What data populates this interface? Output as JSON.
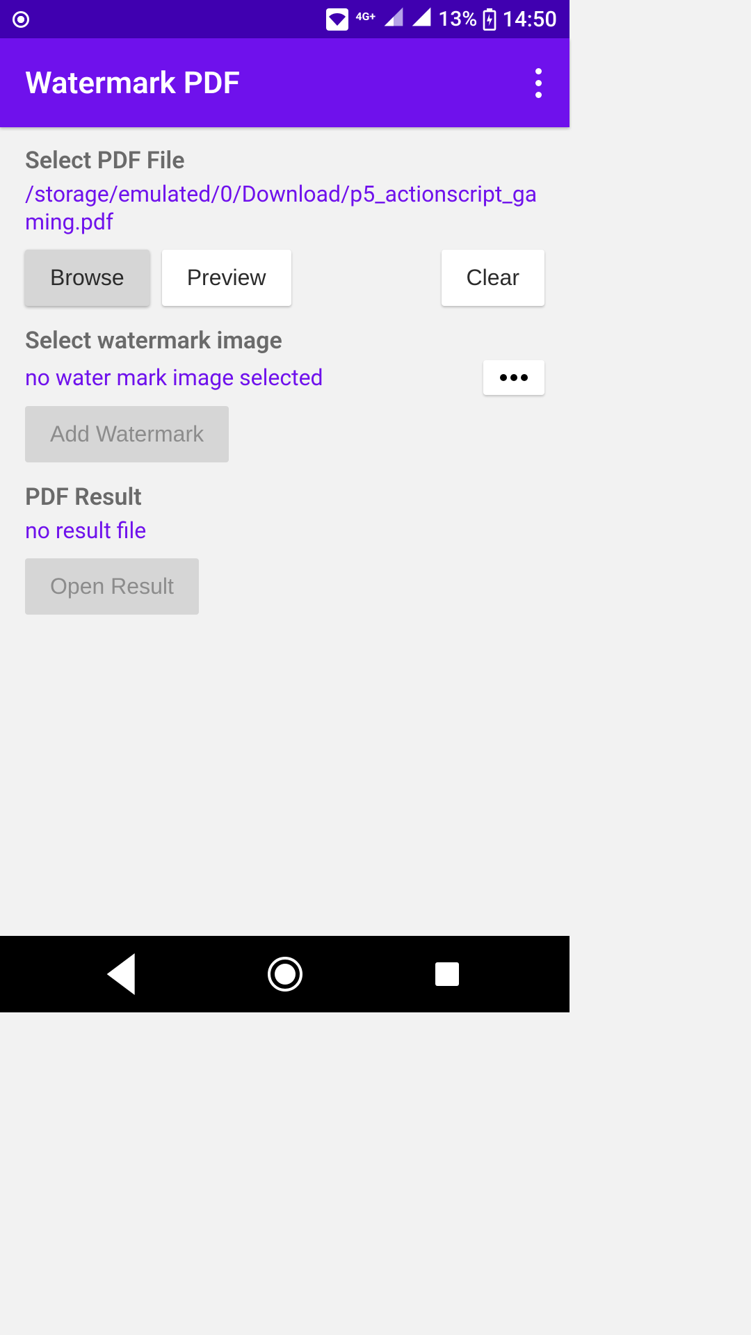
{
  "status": {
    "network_label": "4G+",
    "battery_pct": "13%",
    "time": "14:50"
  },
  "appbar": {
    "title": "Watermark PDF"
  },
  "pdf": {
    "label": "Select PDF File",
    "path": "/storage/emulated/0/Download/p5_actionscript_gaming.pdf",
    "browse": "Browse",
    "preview": "Preview",
    "clear": "Clear"
  },
  "watermark": {
    "label": "Select watermark image",
    "status": "no water mark image selected",
    "add": "Add Watermark"
  },
  "result": {
    "label": "PDF Result",
    "status": "no result file",
    "open": "Open Result"
  }
}
